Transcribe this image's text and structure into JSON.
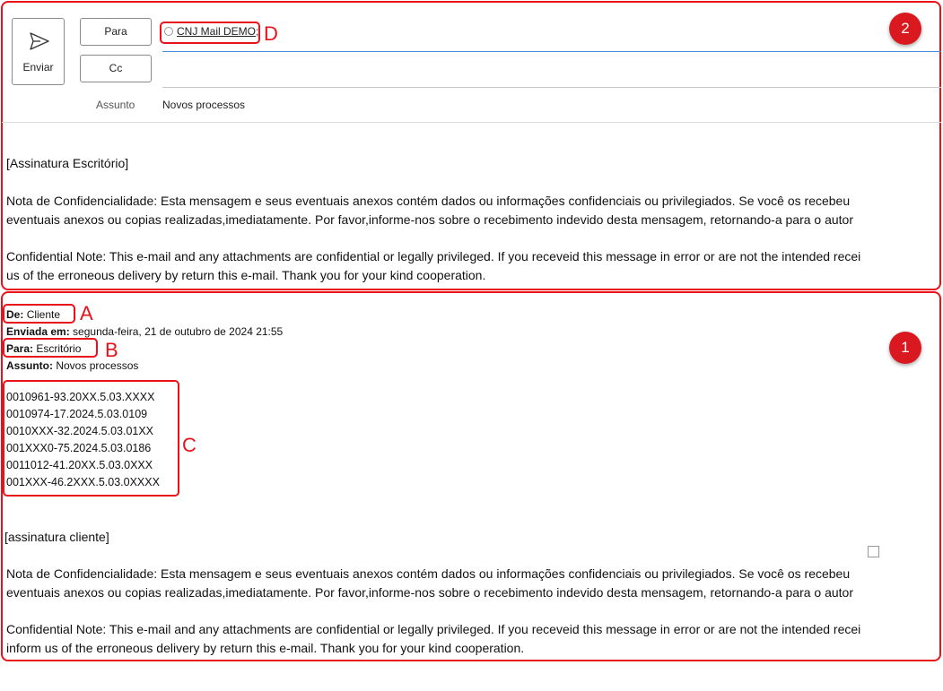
{
  "compose": {
    "send_label": "Enviar",
    "to_label": "Para",
    "cc_label": "Cc",
    "subject_label": "Assunto",
    "subject_value": "Novos processos",
    "recipient": "CNJ Mail DEMO;"
  },
  "reply_body": {
    "signature": "[Assinatura Escritório]",
    "nota_line1": "Nota de Confidencialidade: Esta mensagem e seus eventuais anexos contém  dados  ou informações confidenciais ou privilegiados. Se você os recebeu",
    "nota_line2": "eventuais anexos ou copias realizadas,imediatamente. Por favor,informe-nos sobre o recebimento indevido desta mensagem, retornando-a para o autor",
    "conf_line1": "Confidential Note: This e-mail and any attachments are confidential or legally privileged. If you receveid this message in error or are not the intended recei",
    "conf_line2": "us of the erroneous delivery by return this e-mail. Thank you for your kind cooperation."
  },
  "original": {
    "from_label": "De:",
    "from_value": "Cliente",
    "sent_label": "Enviada em:",
    "sent_value": "segunda-feira, 21 de outubro de 2024 21:55",
    "to_label": "Para:",
    "to_value": "Escritório",
    "subject_label": "Assunto:",
    "subject_value": "Novos processos",
    "processes": [
      "0010961-93.20XX.5.03.XXXX",
      "0010974-17.2024.5.03.0109",
      "0010XXX-32.2024.5.03.01XX",
      "001XXX0-75.2024.5.03.0186",
      "0011012-41.20XX.5.03.0XXX",
      "001XXX-46.2XXX.5.03.0XXXX"
    ],
    "signature": "[assinatura cliente]",
    "nota_line1": "Nota de Confidencialidade: Esta mensagem e seus eventuais anexos contém  dados  ou informações confidenciais ou privilegiados. Se você os recebeu",
    "nota_line2": "eventuais anexos ou copias realizadas,imediatamente. Por favor,informe-nos sobre o recebimento indevido desta mensagem, retornando-a para o autor",
    "conf_line1": "Confidential Note: This e-mail and any attachments are confidential or legally privileged. If you receveid this message in error or are not the intended recei",
    "conf_line2": "inform us of the erroneous delivery by return this e-mail. Thank you for your kind cooperation."
  },
  "annotations": {
    "badge_top": "2",
    "badge_bottom": "1",
    "letter_a": "A",
    "letter_b": "B",
    "letter_c": "C",
    "letter_d": "D"
  },
  "colors": {
    "annotation_red": "#e8131a",
    "badge_red": "#d9191f",
    "to_underline_blue": "#4a90d9"
  }
}
